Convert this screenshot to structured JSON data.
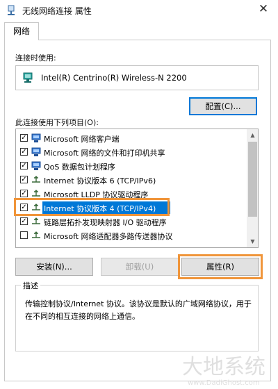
{
  "window": {
    "title": "无线网络连接 属性"
  },
  "tabs": [
    {
      "label": "网络"
    }
  ],
  "connect_using": {
    "label": "连接时使用:",
    "adapter": "Intel(R) Centrino(R) Wireless-N 2200",
    "configure_button": "配置(C)..."
  },
  "items_section": {
    "label": "此连接使用下列项目(O):",
    "items": [
      {
        "label": "Microsoft 网络客户端",
        "checked": true,
        "icon": "network-client-icon"
      },
      {
        "label": "Microsoft 网络的文件和打印机共享",
        "checked": true,
        "icon": "file-printer-sharing-icon"
      },
      {
        "label": "QoS 数据包计划程序",
        "checked": true,
        "icon": "qos-icon"
      },
      {
        "label": "Internet 协议版本 6 (TCP/IPv6)",
        "checked": true,
        "icon": "protocol-icon"
      },
      {
        "label": "Microsoft LLDP 协议驱动程序",
        "checked": true,
        "icon": "protocol-icon"
      },
      {
        "label": "Internet 协议版本 4 (TCP/IPv4)",
        "checked": true,
        "selected": true,
        "icon": "protocol-icon"
      },
      {
        "label": "链路层拓扑发现映射器 I/O 驱动程序",
        "checked": true,
        "icon": "protocol-icon"
      },
      {
        "label": "Microsoft 网络适配器多路传送器协议",
        "checked": false,
        "icon": "protocol-icon"
      }
    ]
  },
  "buttons": {
    "install": "安装(N)...",
    "uninstall": "卸载(U)",
    "properties": "属性(R)"
  },
  "description": {
    "title": "描述",
    "text": "传输控制协议/Internet 协议。该协议是默认的广域网络协议，用于在不同的相互连接的网络上通信。"
  },
  "watermark": {
    "text": "大地系统",
    "url_text": "www.DadiGhost.com"
  },
  "colors": {
    "highlight": "#f0953a",
    "selection": "#0078d7"
  }
}
